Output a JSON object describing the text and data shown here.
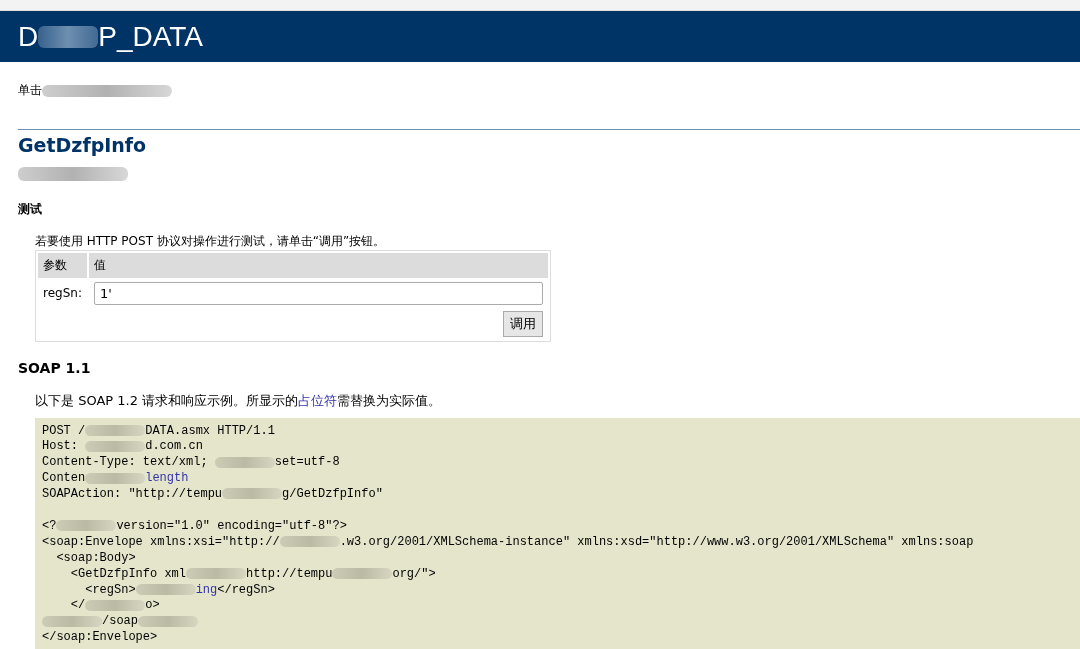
{
  "header": {
    "title_parts": [
      {
        "kind": "text",
        "text": "D"
      },
      {
        "kind": "redacted"
      },
      {
        "kind": "text",
        "text": "P_DATA"
      }
    ]
  },
  "intro": [
    {
      "kind": "text",
      "text": "单击"
    },
    {
      "kind": "redacted"
    }
  ],
  "operation": {
    "title": "GetDzfpInfo",
    "description": [
      {
        "kind": "redacted"
      }
    ]
  },
  "test": {
    "heading": "测试",
    "instructions": "若要使用 HTTP POST 协议对操作进行测试，请单击“调用”按钮。",
    "columns": [
      "参数",
      "值"
    ],
    "params": [
      {
        "label": "regSn:",
        "value": "1'"
      }
    ],
    "invoke_button": "调用"
  },
  "soap": {
    "heading": "SOAP 1.1",
    "note_before": "以下是 SOAP 1.2 请求和响应示例。所显示的",
    "note_link": "占位符",
    "note_after": "需替换为实际值。",
    "code_lines": [
      [
        {
          "kind": "text",
          "text": "POST /"
        },
        {
          "kind": "redacted"
        },
        {
          "kind": "text",
          "text": "DATA.asmx HTTP/1.1"
        }
      ],
      [
        {
          "kind": "text",
          "text": "Host: "
        },
        {
          "kind": "redacted"
        },
        {
          "kind": "text",
          "text": "d.com.cn"
        }
      ],
      [
        {
          "kind": "text",
          "text": "Content-Type: text/xml; "
        },
        {
          "kind": "redacted"
        },
        {
          "kind": "text",
          "text": "set=utf-8"
        }
      ],
      [
        {
          "kind": "text",
          "text": "Conten"
        },
        {
          "kind": "redacted"
        },
        {
          "kind": "placeholder",
          "text": "length"
        }
      ],
      [
        {
          "kind": "text",
          "text": "SOAPAction: \"http://tempu"
        },
        {
          "kind": "redacted"
        },
        {
          "kind": "text",
          "text": "g/GetDzfpInfo\""
        }
      ],
      [
        {
          "kind": "blank"
        }
      ],
      [
        {
          "kind": "text",
          "text": "<?"
        },
        {
          "kind": "redacted"
        },
        {
          "kind": "text",
          "text": "version=\"1.0\" encoding=\"utf-8\"?>"
        }
      ],
      [
        {
          "kind": "text",
          "text": "<soap:Envelope xmlns:xsi=\"http://"
        },
        {
          "kind": "redacted"
        },
        {
          "kind": "text",
          "text": ".w3.org/2001/XMLSchema-instance\" xmlns:xsd=\"http://www.w3.org/2001/XMLSchema\" xmlns:soap"
        }
      ],
      [
        {
          "kind": "text",
          "text": "  <soap:Body>"
        }
      ],
      [
        {
          "kind": "text",
          "text": "    <GetDzfpInfo xml"
        },
        {
          "kind": "redacted"
        },
        {
          "kind": "text",
          "text": "http://tempu"
        },
        {
          "kind": "redacted"
        },
        {
          "kind": "text",
          "text": "org/\">"
        }
      ],
      [
        {
          "kind": "text",
          "text": "      <regSn>"
        },
        {
          "kind": "redacted"
        },
        {
          "kind": "placeholder",
          "text": "ing"
        },
        {
          "kind": "text",
          "text": "</regSn>"
        }
      ],
      [
        {
          "kind": "text",
          "text": "    </"
        },
        {
          "kind": "redacted"
        },
        {
          "kind": "text",
          "text": "o>"
        }
      ],
      [
        {
          "kind": "redacted"
        },
        {
          "kind": "text",
          "text": "/soap"
        },
        {
          "kind": "redacted"
        }
      ],
      [
        {
          "kind": "text",
          "text": "</soap:Envelope>"
        }
      ]
    ]
  }
}
